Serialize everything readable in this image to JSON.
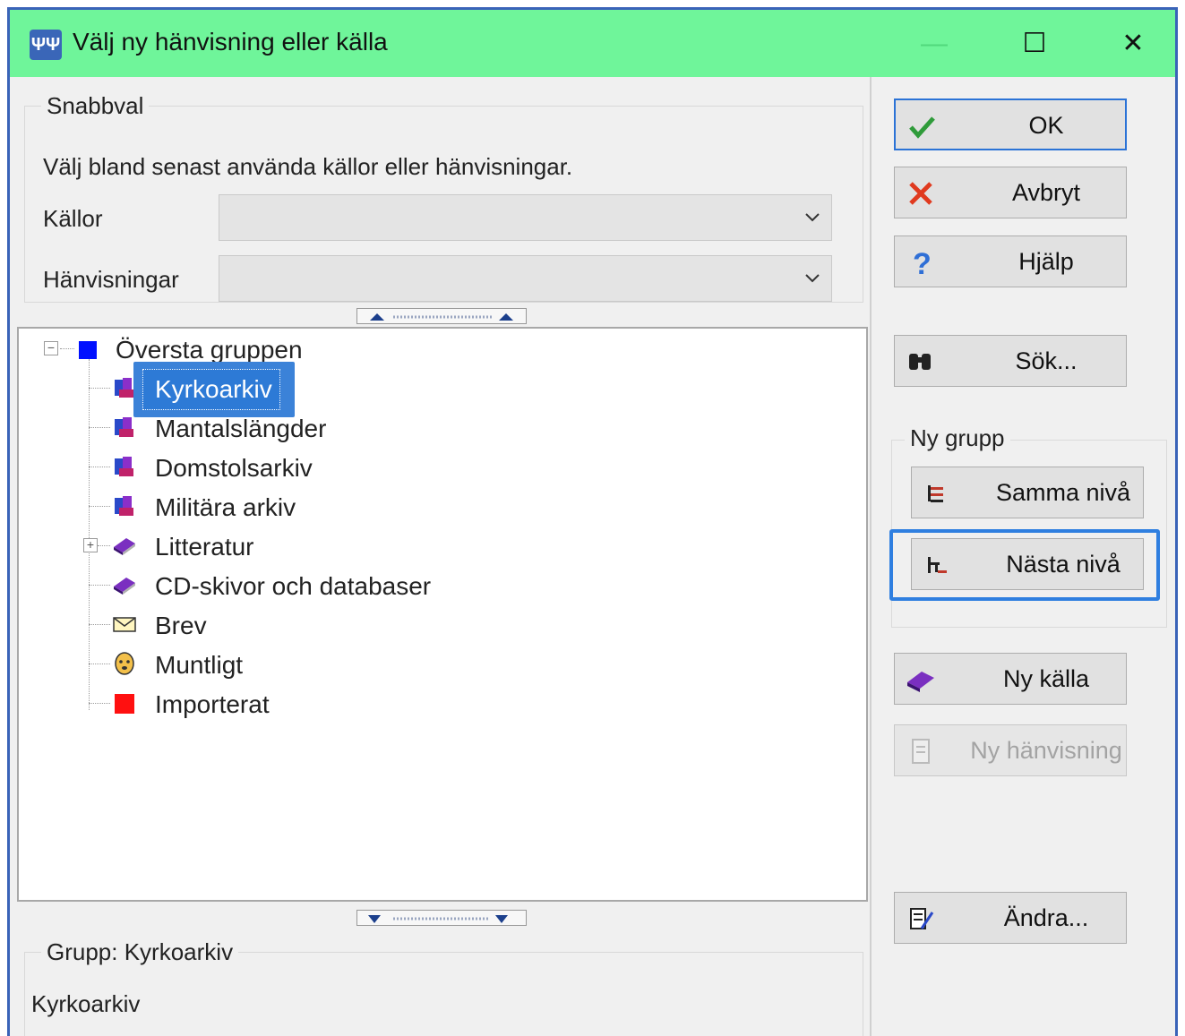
{
  "window": {
    "title": "Välj ny hänvisning eller källa",
    "app_icon": "family-tree-icon",
    "controls": {
      "minimize": "—",
      "maximize": "☐",
      "close": "✕"
    }
  },
  "quick_select": {
    "legend": "Snabbval",
    "description": "Välj bland senast använda källor eller hänvisningar.",
    "sources_label": "Källor",
    "sources_value": "",
    "references_label": "Hänvisningar",
    "references_value": ""
  },
  "tree": {
    "root": {
      "label": "Översta gruppen",
      "icon": "blue-square-icon",
      "expanded": true
    },
    "items": [
      {
        "label": "Kyrkoarkiv",
        "icon": "books-icon",
        "selected": true
      },
      {
        "label": "Mantalslängder",
        "icon": "books-icon"
      },
      {
        "label": "Domstolsarkiv",
        "icon": "books-icon"
      },
      {
        "label": "Militära arkiv",
        "icon": "books-icon"
      },
      {
        "label": "Litteratur",
        "icon": "book-icon",
        "expandable": true
      },
      {
        "label": "CD-skivor och databaser",
        "icon": "book-icon"
      },
      {
        "label": "Brev",
        "icon": "envelope-icon"
      },
      {
        "label": "Muntligt",
        "icon": "face-icon"
      },
      {
        "label": "Importerat",
        "icon": "red-square-icon"
      }
    ]
  },
  "details": {
    "legend": "Grupp: Kyrkoarkiv",
    "text": "Kyrkoarkiv"
  },
  "buttons": {
    "ok": "OK",
    "cancel": "Avbryt",
    "help": "Hjälp",
    "search": "Sök...",
    "new_group_legend": "Ny grupp",
    "same_level": "Samma nivå",
    "next_level": "Nästa nivå",
    "new_source": "Ny källa",
    "new_reference": "Ny hänvisning",
    "edit": "Ändra..."
  },
  "colors": {
    "titlebar": "#6ff59a",
    "selection": "#2d7ad6",
    "highlight_frame": "#2f7fe0",
    "window_border": "#3a63b8"
  }
}
